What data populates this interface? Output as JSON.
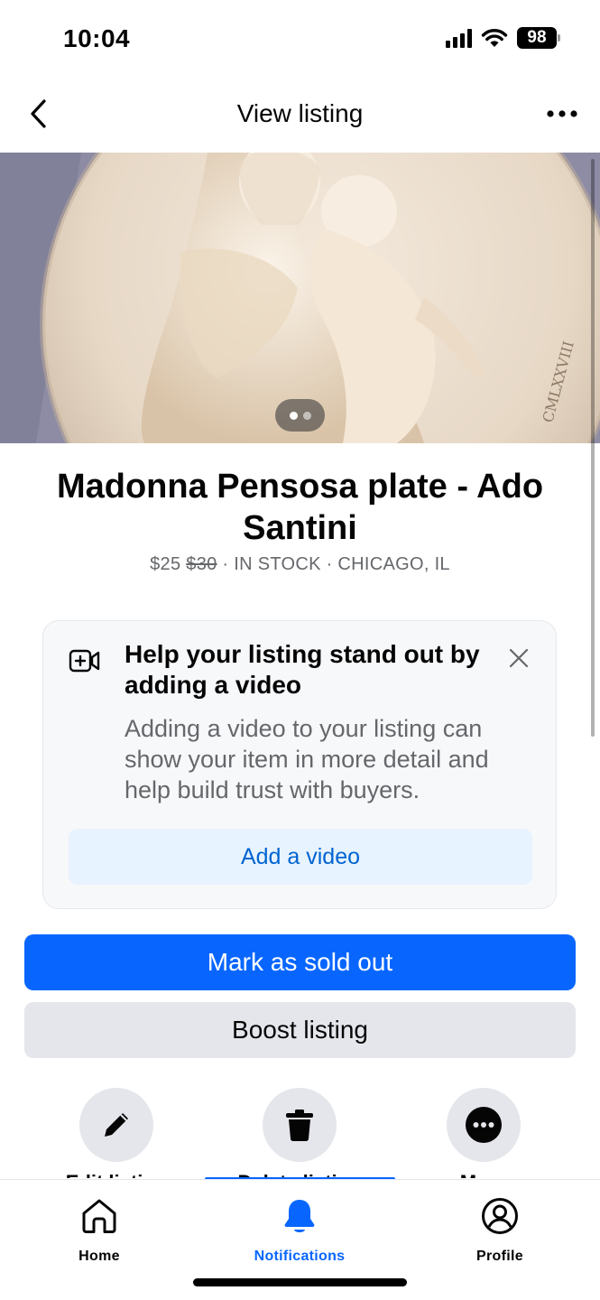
{
  "status_bar": {
    "time": "10:04",
    "battery": "98"
  },
  "header": {
    "title": "View listing"
  },
  "listing": {
    "title": "Madonna Pensosa plate - Ado Santini",
    "price": "$25",
    "original_price": "$30",
    "stock": "IN STOCK",
    "location": "CHICAGO, IL",
    "photo_count": 2,
    "current_photo": 1
  },
  "video_card": {
    "title": "Help your listing stand out by adding a video",
    "body": "Adding a video to your listing can show your item in more detail and help build trust with buyers.",
    "button": "Add a video"
  },
  "buttons": {
    "primary": "Mark as sold out",
    "secondary": "Boost listing"
  },
  "actions": [
    {
      "label": "Edit listing",
      "icon": "pencil-icon"
    },
    {
      "label": "Delete listing",
      "icon": "trash-icon"
    },
    {
      "label": "More",
      "icon": "more-icon"
    }
  ],
  "bottom_nav": {
    "items": [
      {
        "label": "Home",
        "icon": "home-icon"
      },
      {
        "label": "Notifications",
        "icon": "bell-icon",
        "active": true
      },
      {
        "label": "Profile",
        "icon": "profile-icon"
      }
    ]
  },
  "colors": {
    "accent": "#0866ff",
    "secondary_bg": "#e4e6eb",
    "muted_text": "#65676b",
    "link": "#0064d1"
  }
}
